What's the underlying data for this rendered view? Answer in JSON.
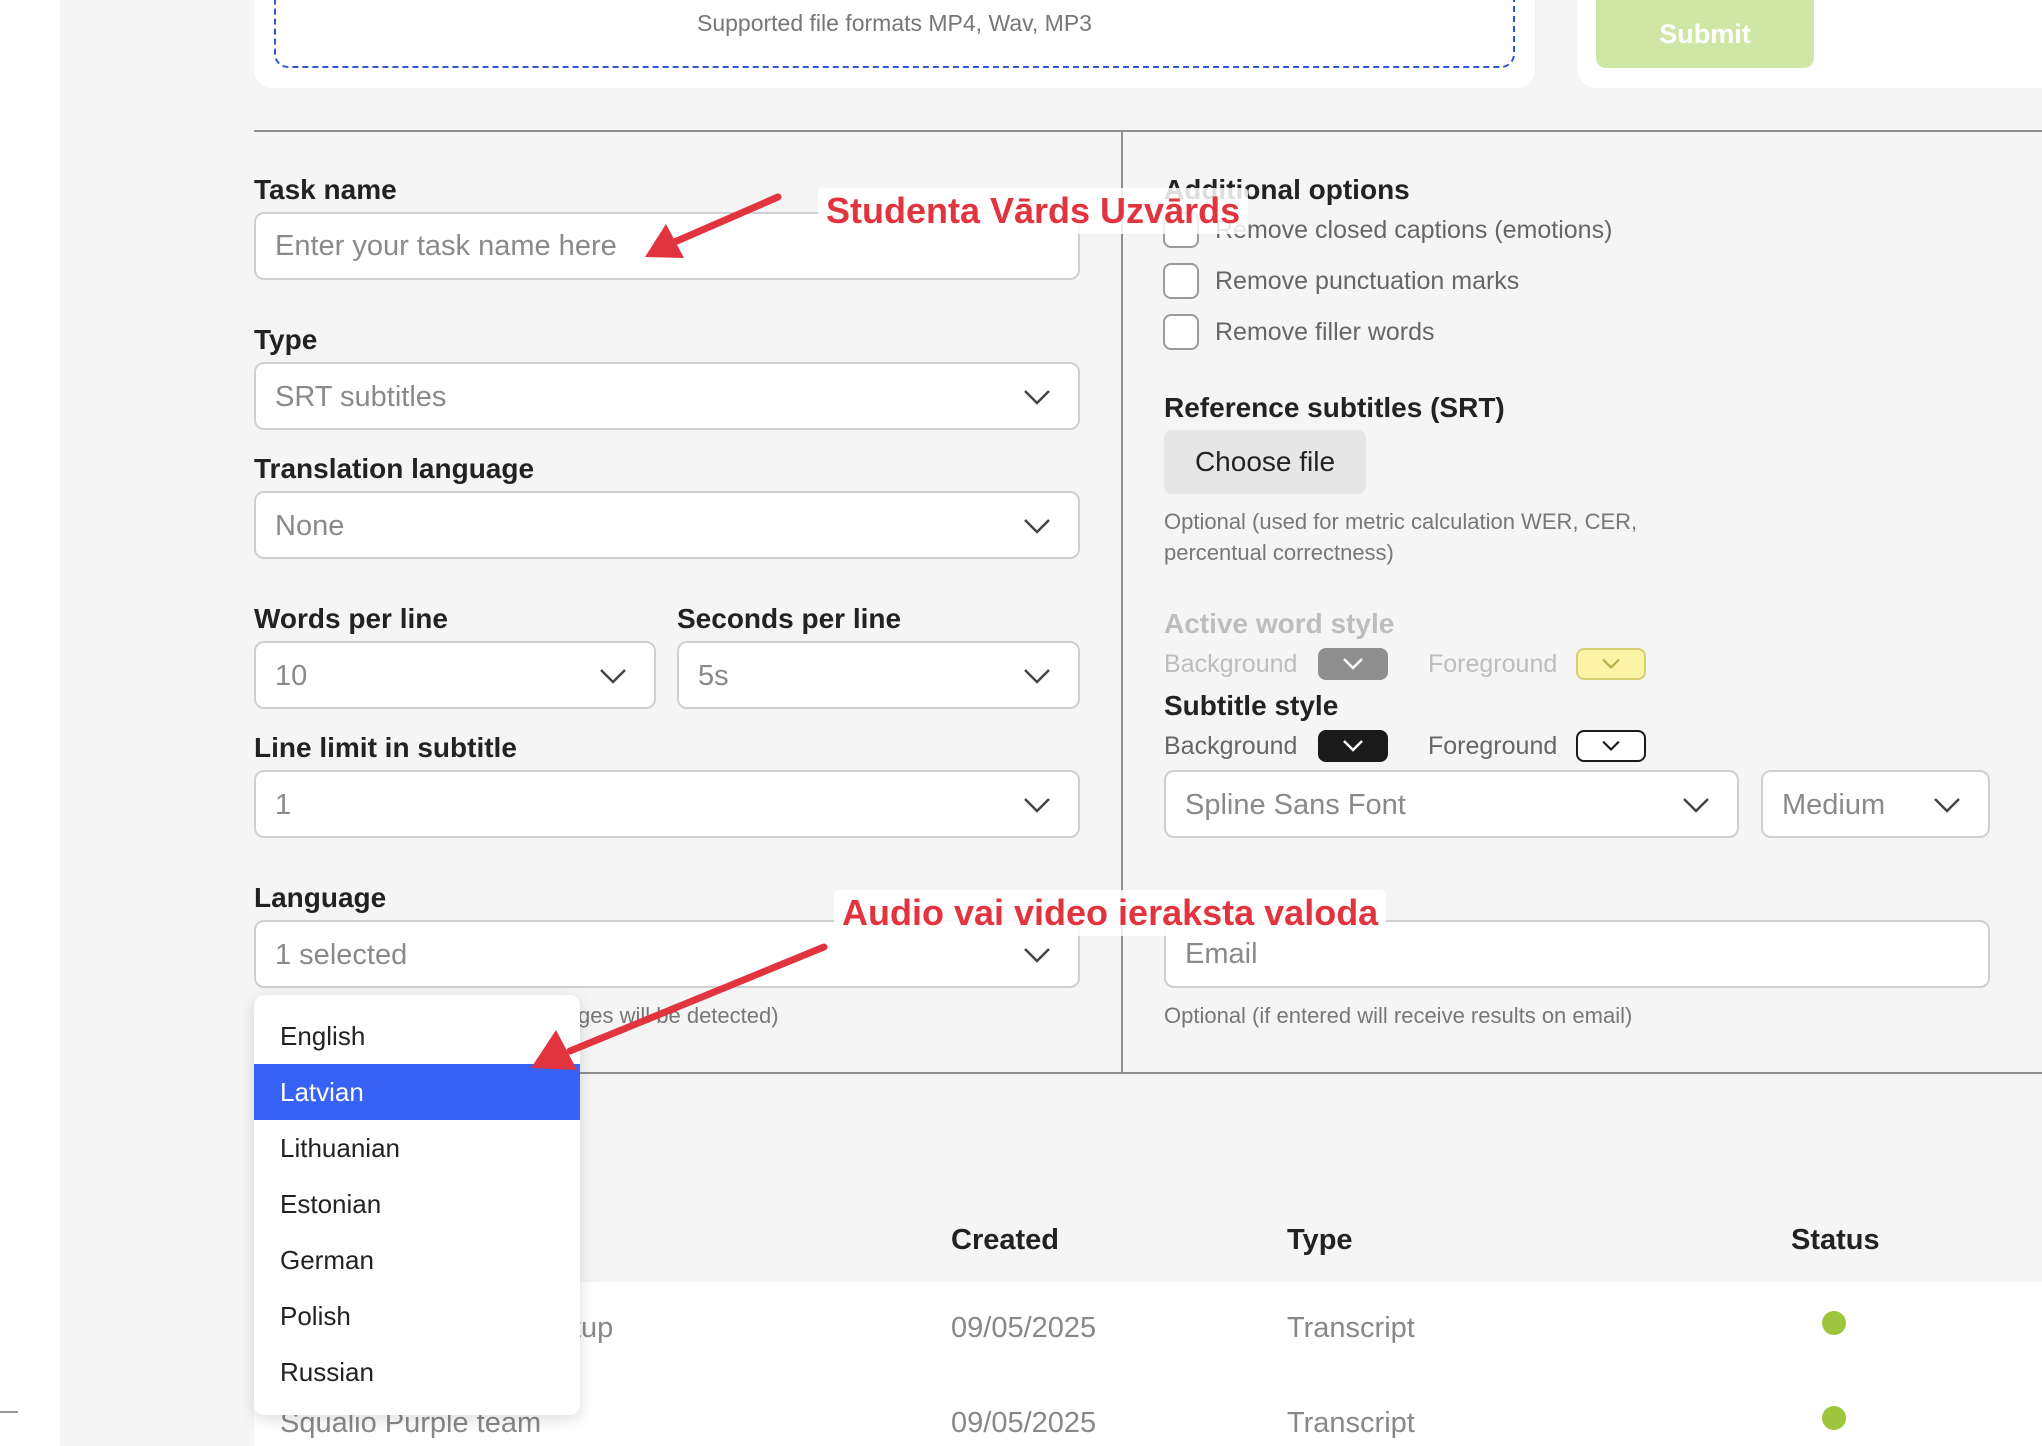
{
  "upload": {
    "formats_text": "Supported file formats MP4, Wav, MP3",
    "submit_label": "Submit"
  },
  "form": {
    "task_name_label": "Task name",
    "task_name_placeholder": "Enter your task name here",
    "type_label": "Type",
    "type_value": "SRT subtitles",
    "translation_label": "Translation language",
    "translation_value": "None",
    "words_label": "Words per line",
    "words_value": "10",
    "seconds_label": "Seconds per line",
    "seconds_value": "5s",
    "line_limit_label": "Line limit in subtitle",
    "line_limit_value": "1",
    "language_label": "Language",
    "language_value": "1 selected",
    "language_hint": "ges will be detected)"
  },
  "options": {
    "title": "Additional options",
    "checkboxes": [
      {
        "label": "Remove closed captions (emotions)",
        "checked": false
      },
      {
        "label": "Remove punctuation marks",
        "checked": false
      },
      {
        "label": "Remove filler words",
        "checked": false
      }
    ],
    "reference_label": "Reference subtitles (SRT)",
    "choose_file_label": "Choose file",
    "reference_hint_line1": "Optional (used for metric calculation WER, CER,",
    "reference_hint_line2": "percentual correctness)",
    "active_word_title": "Active word style",
    "active_bg_label": "Background",
    "active_fg_label": "Foreground",
    "active_bg_color": "#8e8e8e",
    "active_fg_color": "#fbf4a6",
    "subtitle_style_title": "Subtitle style",
    "subtitle_bg_label": "Background",
    "subtitle_fg_label": "Foreground",
    "subtitle_bg_color": "#1a1a1a",
    "subtitle_fg_color": "#ffffff",
    "font_value": "Spline Sans Font",
    "size_value": "Medium",
    "email_placeholder": "Email",
    "email_hint": "Optional (if entered will receive results on email)"
  },
  "language_menu": {
    "items": [
      "English",
      "Latvian",
      "Lithuanian",
      "Estonian",
      "German",
      "Polish",
      "Russian"
    ],
    "selected": "Latvian"
  },
  "table": {
    "headers": {
      "created": "Created",
      "type": "Type",
      "status": "Status"
    },
    "rows": [
      {
        "name": "tup",
        "created": "09/05/2025",
        "type": "Transcript",
        "status_color": "#9dc63d"
      },
      {
        "name": "Squalio Purple team",
        "created": "09/05/2025",
        "type": "Transcript",
        "status_color": "#9dc63d"
      }
    ]
  },
  "annotations": {
    "task_name_note": "Studenta Vārds Uzvārds",
    "language_note": "Audio vai video ieraksta valoda"
  },
  "colors": {
    "accent": "#3762f5",
    "annotation": "#e2343f",
    "submit_disabled": "#cfe6a5",
    "status_ok": "#9dc63d"
  }
}
